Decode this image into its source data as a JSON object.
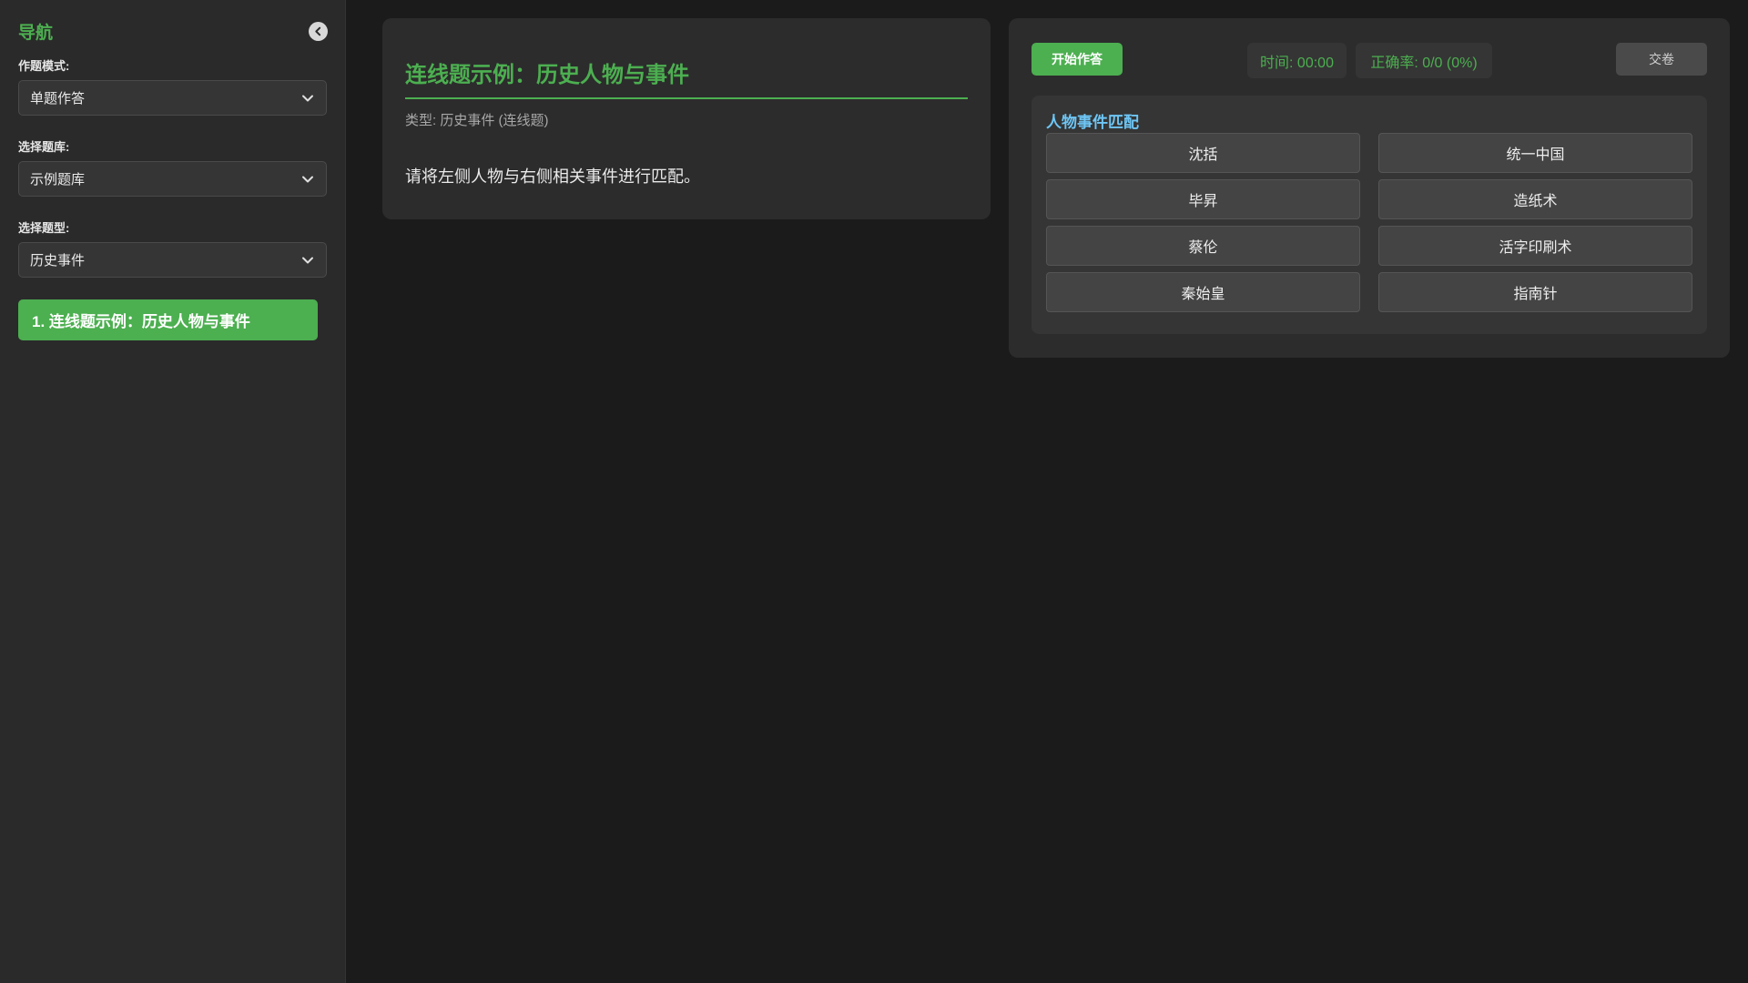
{
  "sidebar": {
    "title": "导航",
    "mode_label": "作题模式:",
    "mode_value": "单题作答",
    "bank_label": "选择题库:",
    "bank_value": "示例题库",
    "type_label": "选择题型:",
    "type_value": "历史事件",
    "questions": [
      {
        "label": "1. 连线题示例：历史人物与事件"
      }
    ]
  },
  "question": {
    "title": "连线题示例：历史人物与事件",
    "type_text": "类型: 历史事件 (连线题)",
    "prompt": "请将左侧人物与右侧相关事件进行匹配。"
  },
  "answer": {
    "start_label": "开始作答",
    "time_text": "时间: 00:00",
    "accuracy_text": "正确率: 0/0 (0%)",
    "submit_label": "交卷",
    "match_title": "人物事件匹配",
    "left_items": [
      "沈括",
      "毕昇",
      "蔡伦",
      "秦始皇"
    ],
    "right_items": [
      "统一中国",
      "造纸术",
      "活字印刷术",
      "指南针"
    ]
  },
  "colors": {
    "accent": "#4caf50",
    "match_title": "#6ec6f5",
    "background": "#1b1b1b"
  }
}
